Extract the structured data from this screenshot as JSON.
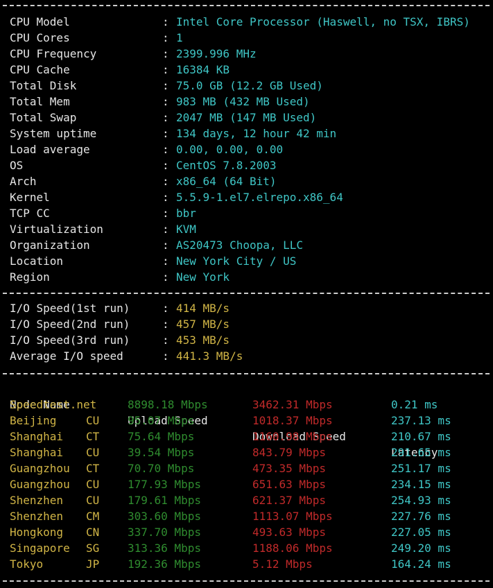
{
  "colors": {
    "label": "#e6e6e6",
    "value": "#3fc6c6",
    "io": "#d1b546",
    "node": "#d1b546",
    "upload": "#2f8c2f",
    "download": "#c12a2a",
    "latency": "#3fc6c6"
  },
  "sysinfo": [
    {
      "label": "CPU Model",
      "value": "Intel Core Processor (Haswell, no TSX, IBRS)"
    },
    {
      "label": "CPU Cores",
      "value": "1"
    },
    {
      "label": "CPU Frequency",
      "value": "2399.996 MHz"
    },
    {
      "label": "CPU Cache",
      "value": "16384 KB"
    },
    {
      "label": "Total Disk",
      "value": "75.0 GB (12.2 GB Used)"
    },
    {
      "label": "Total Mem",
      "value": "983 MB (432 MB Used)"
    },
    {
      "label": "Total Swap",
      "value": "2047 MB (147 MB Used)"
    },
    {
      "label": "System uptime",
      "value": "134 days, 12 hour 42 min"
    },
    {
      "label": "Load average",
      "value": "0.00, 0.00, 0.00"
    },
    {
      "label": "OS",
      "value": "CentOS 7.8.2003"
    },
    {
      "label": "Arch",
      "value": "x86_64 (64 Bit)"
    },
    {
      "label": "Kernel",
      "value": "5.5.9-1.el7.elrepo.x86_64"
    },
    {
      "label": "TCP CC",
      "value": "bbr"
    },
    {
      "label": "Virtualization",
      "value": "KVM"
    },
    {
      "label": "Organization",
      "value": "AS20473 Choopa, LLC"
    },
    {
      "label": "Location",
      "value": "New York City / US"
    },
    {
      "label": "Region",
      "value": "New York"
    }
  ],
  "colon": ":",
  "io": [
    {
      "label": "I/O Speed(1st run)",
      "value": "414 MB/s"
    },
    {
      "label": "I/O Speed(2nd run)",
      "value": "457 MB/s"
    },
    {
      "label": "I/O Speed(3rd run)",
      "value": "453 MB/s"
    },
    {
      "label": "Average I/O speed",
      "value": "441.3 MB/s"
    }
  ],
  "speed_headers": {
    "node": "Node Name",
    "upload": "Upload Speed",
    "download": "Download Speed",
    "latency": "Latency"
  },
  "speed_rows": [
    {
      "node": "Speedtest.net",
      "code": "",
      "upload": "8898.18 Mbps",
      "download": "3462.31 Mbps",
      "latency": "0.21 ms"
    },
    {
      "node": "Beijing",
      "code": "CU",
      "upload": "95.07 Mbps",
      "download": "1018.37 Mbps",
      "latency": "237.13 ms"
    },
    {
      "node": "Shanghai",
      "code": "CT",
      "upload": "75.64 Mbps",
      "download": "1160.98 Mbps",
      "latency": "210.67 ms"
    },
    {
      "node": "Shanghai",
      "code": "CU",
      "upload": "39.54 Mbps",
      "download": "843.79 Mbps",
      "latency": "291.65 ms"
    },
    {
      "node": "Guangzhou",
      "code": "CT",
      "upload": "70.70 Mbps",
      "download": "473.35 Mbps",
      "latency": "251.17 ms"
    },
    {
      "node": "Guangzhou",
      "code": "CU",
      "upload": "177.93 Mbps",
      "download": "651.63 Mbps",
      "latency": "234.15 ms"
    },
    {
      "node": "Shenzhen",
      "code": "CU",
      "upload": "179.61 Mbps",
      "download": "621.37 Mbps",
      "latency": "254.93 ms"
    },
    {
      "node": "Shenzhen",
      "code": "CM",
      "upload": "303.60 Mbps",
      "download": "1113.07 Mbps",
      "latency": "227.76 ms"
    },
    {
      "node": "Hongkong",
      "code": "CN",
      "upload": "337.70 Mbps",
      "download": "493.63 Mbps",
      "latency": "227.05 ms"
    },
    {
      "node": "Singapore",
      "code": "SG",
      "upload": "313.36 Mbps",
      "download": "1188.06 Mbps",
      "latency": "249.20 ms"
    },
    {
      "node": "Tokyo",
      "code": "JP",
      "upload": "192.36 Mbps",
      "download": "5.12 Mbps",
      "latency": "164.24 ms"
    }
  ]
}
